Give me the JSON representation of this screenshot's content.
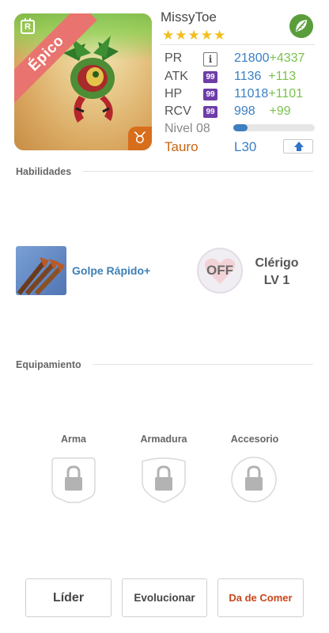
{
  "monster": {
    "name": "MissyToe",
    "rarity": "Épico",
    "stars": "★★★★★",
    "element_icon": "leaf-icon",
    "zodiac_symbol": "♉",
    "rarity_badge": "R"
  },
  "stats": {
    "pr": {
      "label": "PR",
      "value": "21800",
      "bonus": "+4337"
    },
    "atk": {
      "label": "ATK",
      "badge": "99",
      "value": "1136",
      "bonus": "+113"
    },
    "hp": {
      "label": "HP",
      "badge": "99",
      "value": "11018",
      "bonus": "+1101"
    },
    "rcv": {
      "label": "RCV",
      "badge": "99",
      "value": "998",
      "bonus": "+99"
    },
    "level": {
      "label": "Nivel 08",
      "progress": 0.17
    },
    "sign": "Tauro",
    "max_level": "L30"
  },
  "sections": {
    "skills": "Habilidades",
    "equipment": "Equipamiento"
  },
  "skills": {
    "active_name": "Golpe Rápido+",
    "leader_state": "OFF",
    "class_name": "Clérigo",
    "class_level": "LV 1"
  },
  "equipment": {
    "weapon": "Arma",
    "armor": "Armadura",
    "accessory": "Accesorio"
  },
  "buttons": {
    "leader": "Líder",
    "evolve": "Evolucionar",
    "feed": "Da de Comer"
  }
}
